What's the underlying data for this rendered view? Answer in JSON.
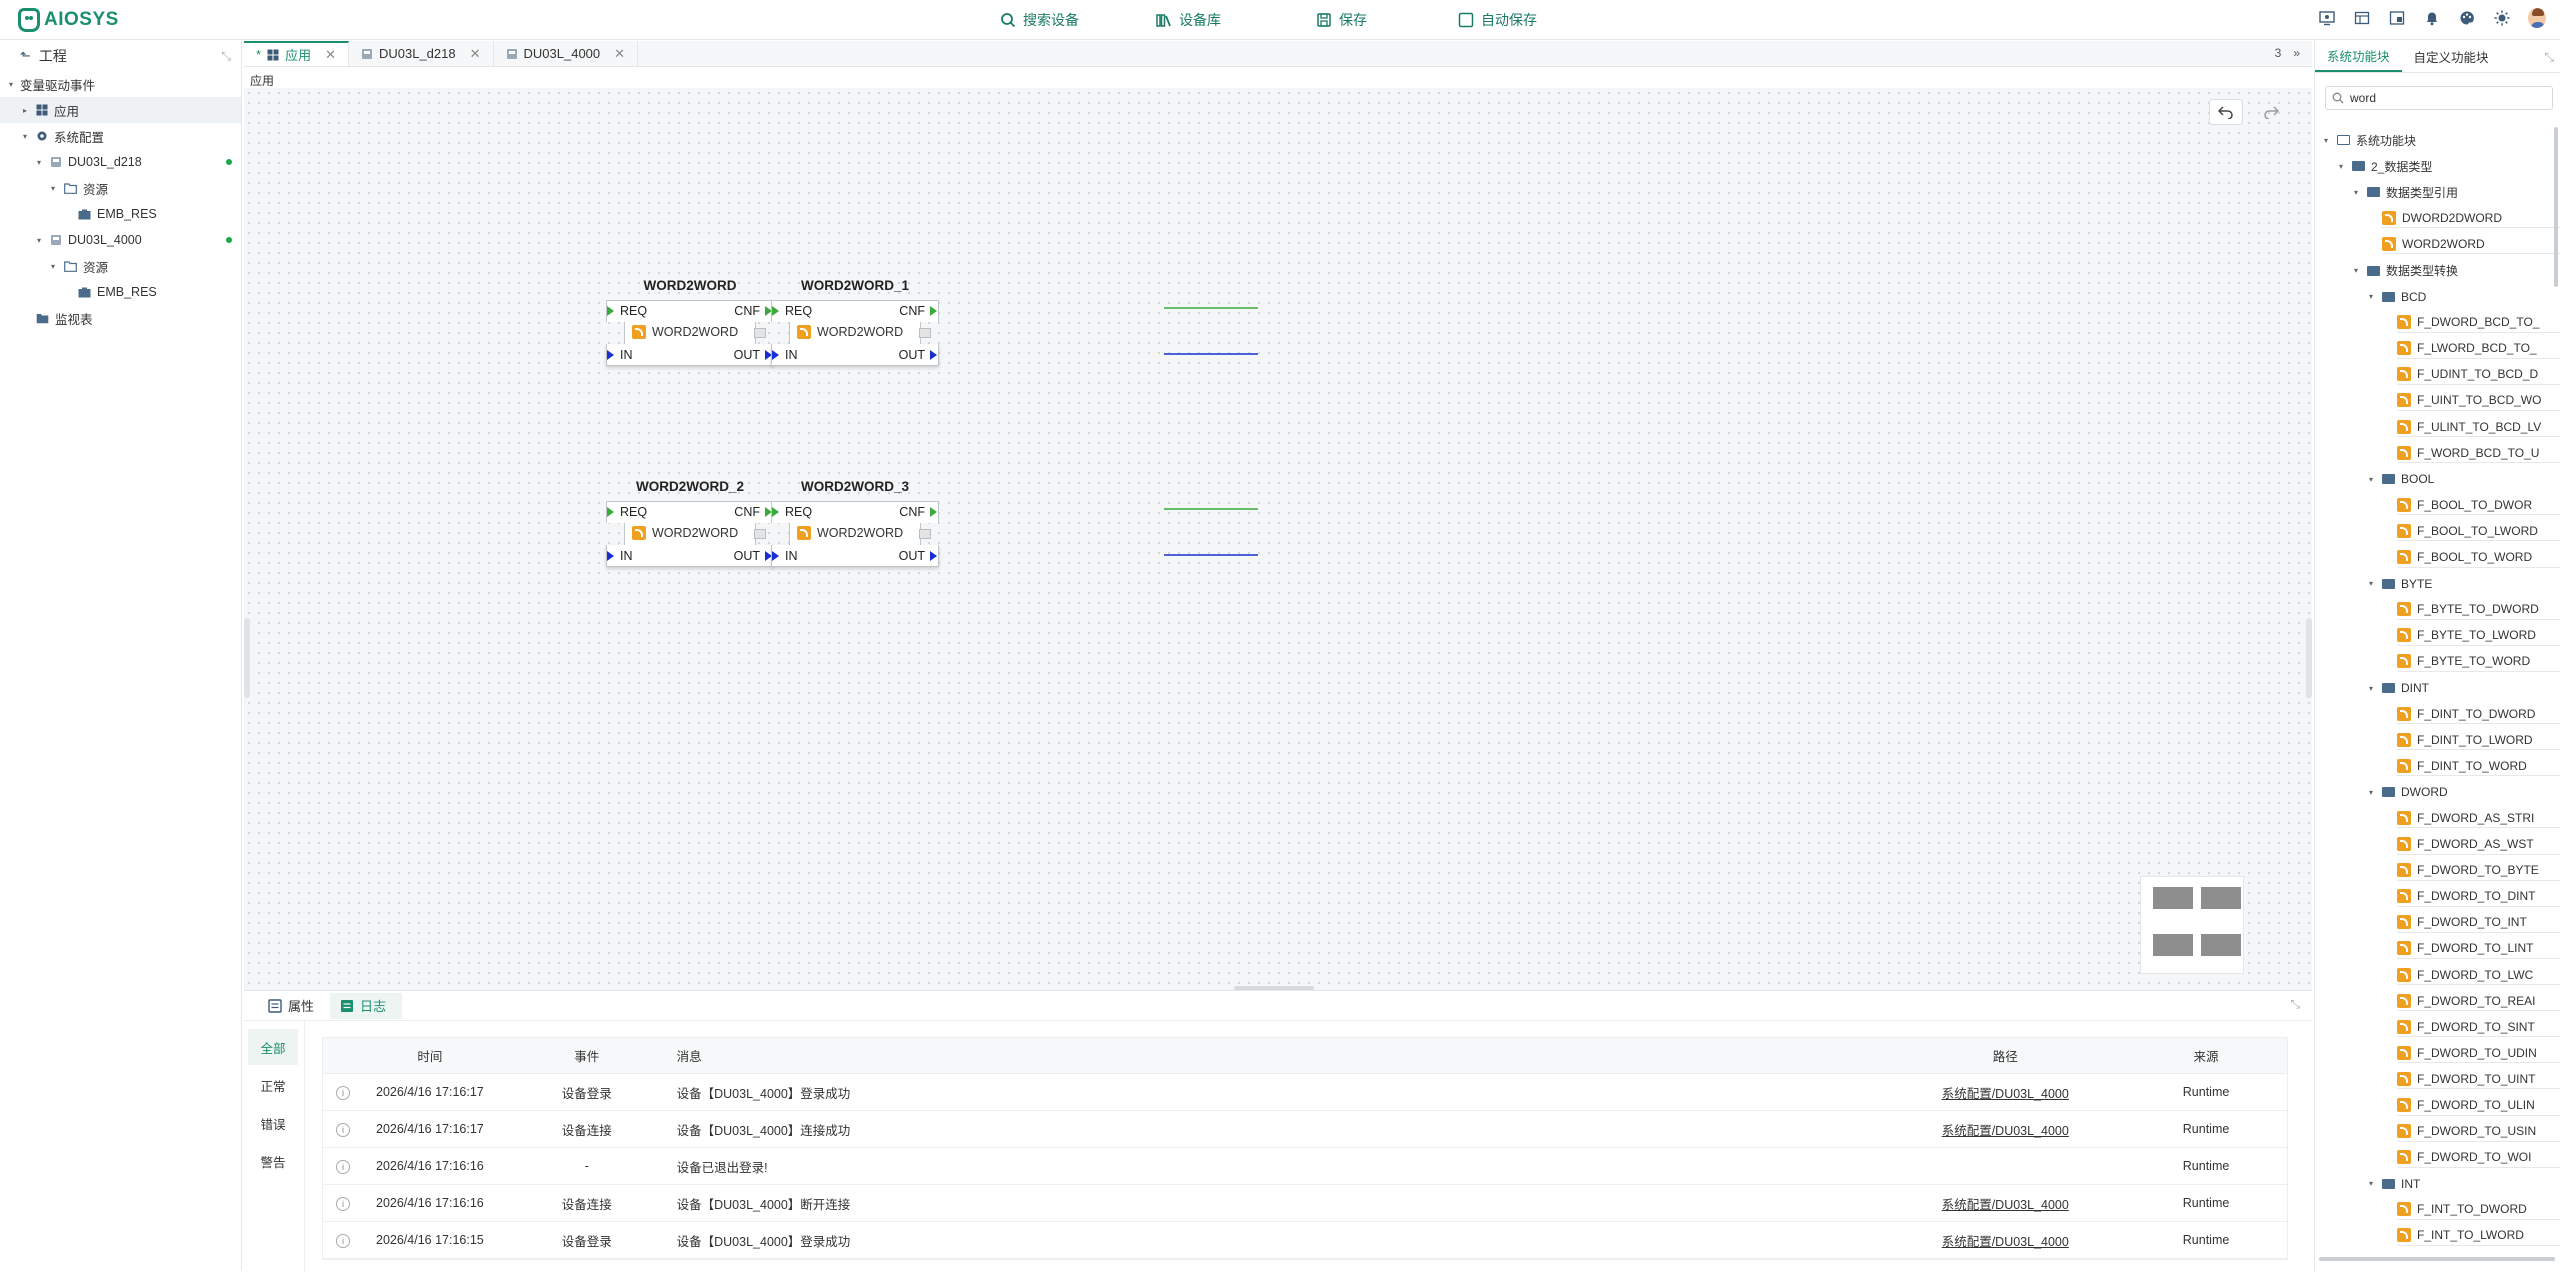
{
  "brand": {
    "name": "AIOSYS"
  },
  "toolbar": {
    "search": "搜索设备",
    "library": "设备库",
    "save": "保存",
    "autosave": "自动保存"
  },
  "header_icons": [
    "monitor-icon",
    "table-icon",
    "window-icon",
    "bell-icon",
    "palette-icon",
    "sun-icon",
    "avatar"
  ],
  "left_panel": {
    "title": "工程",
    "tree": [
      {
        "label": "变量驱动事件",
        "indent": 0,
        "arrow": "▾",
        "icon": "none"
      },
      {
        "label": "应用",
        "indent": 1,
        "arrow": "▸",
        "icon": "grid",
        "selected": true
      },
      {
        "label": "系统配置",
        "indent": 1,
        "arrow": "▾",
        "icon": "gear"
      },
      {
        "label": "DU03L_d218",
        "indent": 2,
        "arrow": "▾",
        "icon": "device",
        "online": true
      },
      {
        "label": "资源",
        "indent": 3,
        "arrow": "▾",
        "icon": "folder"
      },
      {
        "label": "EMB_RES",
        "indent": 4,
        "arrow": "",
        "icon": "res"
      },
      {
        "label": "DU03L_4000",
        "indent": 2,
        "arrow": "▾",
        "icon": "device",
        "online": true
      },
      {
        "label": "资源",
        "indent": 3,
        "arrow": "▾",
        "icon": "folder"
      },
      {
        "label": "EMB_RES",
        "indent": 4,
        "arrow": "",
        "icon": "res"
      },
      {
        "label": "监视表",
        "indent": 1,
        "arrow": "",
        "icon": "table"
      }
    ]
  },
  "doc_tabs": [
    {
      "label": "应用",
      "active": true
    },
    {
      "label": "DU03L_d218",
      "active": false
    },
    {
      "label": "DU03L_4000",
      "active": false
    }
  ],
  "tab_count": "3",
  "breadcrumb": "应用",
  "blocks": [
    {
      "name": "WORD2WORD",
      "type": "WORD2WORD",
      "req": "REQ",
      "cnf": "CNF",
      "in": "IN",
      "out": "OUT"
    },
    {
      "name": "WORD2WORD_1",
      "type": "WORD2WORD",
      "req": "REQ",
      "cnf": "CNF",
      "in": "IN",
      "out": "OUT"
    },
    {
      "name": "WORD2WORD_2",
      "type": "WORD2WORD",
      "req": "REQ",
      "cnf": "CNF",
      "in": "IN",
      "out": "OUT"
    },
    {
      "name": "WORD2WORD_3",
      "type": "WORD2WORD",
      "req": "REQ",
      "cnf": "CNF",
      "in": "IN",
      "out": "OUT"
    }
  ],
  "colors": {
    "accent": "#1a8f6e",
    "event_wire": "#3aaa3a",
    "data_wire": "#1a2fd0",
    "fb_icon": "#f0a020"
  },
  "bottom_panel": {
    "tabs": [
      "属性",
      "日志"
    ],
    "active_tab": "日志",
    "filters": [
      "全部",
      "正常",
      "错误",
      "警告"
    ],
    "columns": {
      "time": "时间",
      "event": "事件",
      "message": "消息",
      "path": "路径",
      "source": "来源"
    },
    "rows": [
      {
        "time": "2026/4/16 17:16:17",
        "event": "设备登录",
        "message": "设备【DU03L_4000】登录成功",
        "path": "系统配置/DU03L_4000",
        "source": "Runtime"
      },
      {
        "time": "2026/4/16 17:16:17",
        "event": "设备连接",
        "message": "设备【DU03L_4000】连接成功",
        "path": "系统配置/DU03L_4000",
        "source": "Runtime"
      },
      {
        "time": "2026/4/16 17:16:16",
        "event": "-",
        "message": "设备已退出登录!",
        "path": "",
        "source": "Runtime"
      },
      {
        "time": "2026/4/16 17:16:16",
        "event": "设备连接",
        "message": "设备【DU03L_4000】断开连接",
        "path": "系统配置/DU03L_4000",
        "source": "Runtime"
      },
      {
        "time": "2026/4/16 17:16:15",
        "event": "设备登录",
        "message": "设备【DU03L_4000】登录成功",
        "path": "系统配置/DU03L_4000",
        "source": "Runtime"
      }
    ]
  },
  "right_panel": {
    "tabs": [
      "系统功能块",
      "自定义功能块"
    ],
    "active_tab": "系统功能块",
    "search_value": "word",
    "tree": [
      {
        "label": "系统功能块",
        "indent": 0,
        "arrow": "▾",
        "kind": "folder-open"
      },
      {
        "label": "2_数据类型",
        "indent": 1,
        "arrow": "▾",
        "kind": "folder"
      },
      {
        "label": "数据类型引用",
        "indent": 2,
        "arrow": "▾",
        "kind": "folder"
      },
      {
        "label": "DWORD2DWORD",
        "indent": 3,
        "arrow": "",
        "kind": "fb"
      },
      {
        "label": "WORD2WORD",
        "indent": 3,
        "arrow": "",
        "kind": "fb"
      },
      {
        "label": "数据类型转换",
        "indent": 2,
        "arrow": "▾",
        "kind": "folder"
      },
      {
        "label": "BCD",
        "indent": 3,
        "arrow": "▾",
        "kind": "folder"
      },
      {
        "label": "F_DWORD_BCD_TO_",
        "indent": 4,
        "arrow": "",
        "kind": "fb"
      },
      {
        "label": "F_LWORD_BCD_TO_",
        "indent": 4,
        "arrow": "",
        "kind": "fb"
      },
      {
        "label": "F_UDINT_TO_BCD_D",
        "indent": 4,
        "arrow": "",
        "kind": "fb"
      },
      {
        "label": "F_UINT_TO_BCD_WO",
        "indent": 4,
        "arrow": "",
        "kind": "fb"
      },
      {
        "label": "F_ULINT_TO_BCD_LV",
        "indent": 4,
        "arrow": "",
        "kind": "fb"
      },
      {
        "label": "F_WORD_BCD_TO_U",
        "indent": 4,
        "arrow": "",
        "kind": "fb"
      },
      {
        "label": "BOOL",
        "indent": 3,
        "arrow": "▾",
        "kind": "folder"
      },
      {
        "label": "F_BOOL_TO_DWOR",
        "indent": 4,
        "arrow": "",
        "kind": "fb"
      },
      {
        "label": "F_BOOL_TO_LWORD",
        "indent": 4,
        "arrow": "",
        "kind": "fb"
      },
      {
        "label": "F_BOOL_TO_WORD",
        "indent": 4,
        "arrow": "",
        "kind": "fb"
      },
      {
        "label": "BYTE",
        "indent": 3,
        "arrow": "▾",
        "kind": "folder"
      },
      {
        "label": "F_BYTE_TO_DWORD",
        "indent": 4,
        "arrow": "",
        "kind": "fb"
      },
      {
        "label": "F_BYTE_TO_LWORD",
        "indent": 4,
        "arrow": "",
        "kind": "fb"
      },
      {
        "label": "F_BYTE_TO_WORD",
        "indent": 4,
        "arrow": "",
        "kind": "fb"
      },
      {
        "label": "DINT",
        "indent": 3,
        "arrow": "▾",
        "kind": "folder"
      },
      {
        "label": "F_DINT_TO_DWORD",
        "indent": 4,
        "arrow": "",
        "kind": "fb"
      },
      {
        "label": "F_DINT_TO_LWORD",
        "indent": 4,
        "arrow": "",
        "kind": "fb"
      },
      {
        "label": "F_DINT_TO_WORD",
        "indent": 4,
        "arrow": "",
        "kind": "fb"
      },
      {
        "label": "DWORD",
        "indent": 3,
        "arrow": "▾",
        "kind": "folder"
      },
      {
        "label": "F_DWORD_AS_STRI",
        "indent": 4,
        "arrow": "",
        "kind": "fb"
      },
      {
        "label": "F_DWORD_AS_WST",
        "indent": 4,
        "arrow": "",
        "kind": "fb"
      },
      {
        "label": "F_DWORD_TO_BYTE",
        "indent": 4,
        "arrow": "",
        "kind": "fb"
      },
      {
        "label": "F_DWORD_TO_DINT",
        "indent": 4,
        "arrow": "",
        "kind": "fb"
      },
      {
        "label": "F_DWORD_TO_INT",
        "indent": 4,
        "arrow": "",
        "kind": "fb"
      },
      {
        "label": "F_DWORD_TO_LINT",
        "indent": 4,
        "arrow": "",
        "kind": "fb"
      },
      {
        "label": "F_DWORD_TO_LWC",
        "indent": 4,
        "arrow": "",
        "kind": "fb"
      },
      {
        "label": "F_DWORD_TO_REAI",
        "indent": 4,
        "arrow": "",
        "kind": "fb"
      },
      {
        "label": "F_DWORD_TO_SINT",
        "indent": 4,
        "arrow": "",
        "kind": "fb"
      },
      {
        "label": "F_DWORD_TO_UDIN",
        "indent": 4,
        "arrow": "",
        "kind": "fb"
      },
      {
        "label": "F_DWORD_TO_UINT",
        "indent": 4,
        "arrow": "",
        "kind": "fb"
      },
      {
        "label": "F_DWORD_TO_ULIN",
        "indent": 4,
        "arrow": "",
        "kind": "fb"
      },
      {
        "label": "F_DWORD_TO_USIN",
        "indent": 4,
        "arrow": "",
        "kind": "fb"
      },
      {
        "label": "F_DWORD_TO_WOI",
        "indent": 4,
        "arrow": "",
        "kind": "fb"
      },
      {
        "label": "INT",
        "indent": 3,
        "arrow": "▾",
        "kind": "folder"
      },
      {
        "label": "F_INT_TO_DWORD",
        "indent": 4,
        "arrow": "",
        "kind": "fb"
      },
      {
        "label": "F_INT_TO_LWORD",
        "indent": 4,
        "arrow": "",
        "kind": "fb"
      }
    ]
  }
}
